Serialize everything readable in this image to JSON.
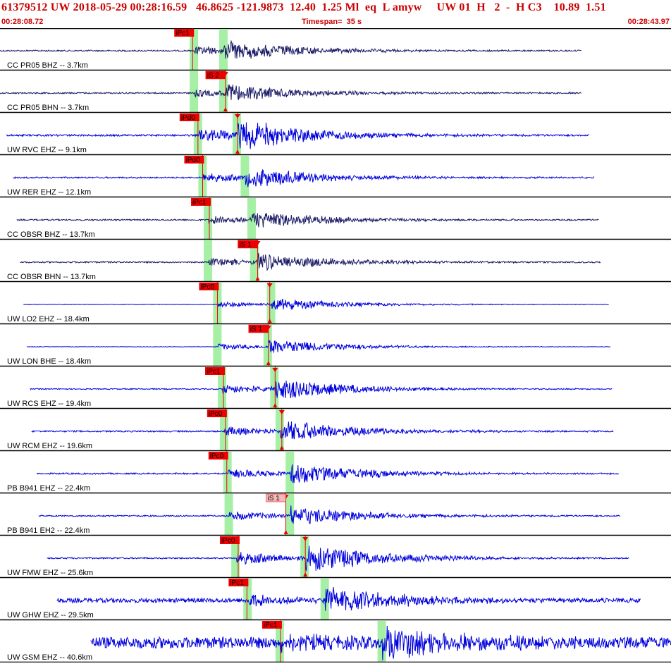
{
  "header": {
    "title": "61379512 UW 2018-05-29 00:28:16.59   46.8625 -121.9873  12.40  1.25 Ml  eq  L amyw     UW 01  H   2  -  H C3    10.89  1.51",
    "start_time": "00:28:08.72",
    "timespan": "Timespan=  35 s",
    "end_time": "00:28:43.97"
  },
  "colors": {
    "title_red": "#cc0000",
    "pick_red": "#ee0000",
    "pick_pink": "#f4b8b8",
    "window_green": "#a6f0a6",
    "trace_blue": "#0000dd",
    "trace_dark": "#1a1a66"
  },
  "traces": [
    {
      "label": "CC PR05 BHZ -- 3.7km",
      "color": "dark",
      "start": 0.0,
      "end": 0.867,
      "p": 0.29,
      "s": 0.334,
      "amp": 0.55,
      "noise": 0.04,
      "ppick": "iPc1",
      "ppick_at": 0.287,
      "spick": "",
      "spick_at": null
    },
    {
      "label": "CC PR05 BHN -- 3.7km",
      "color": "dark",
      "start": 0.0,
      "end": 0.867,
      "p": 0.29,
      "s": 0.334,
      "amp": 0.5,
      "noise": 0.04,
      "ppick": "",
      "ppick_at": null,
      "spick": "iS 2",
      "spick_at": 0.336
    },
    {
      "label": "UW RVC EHZ -- 9.1km",
      "color": "blue",
      "start": 0.01,
      "end": 0.878,
      "p": 0.296,
      "s": 0.354,
      "amp": 0.85,
      "noise": 0.05,
      "ppick": "iPd0",
      "ppick_at": 0.295,
      "spick": "",
      "spick_at": 0.354
    },
    {
      "label": "UW RER EHZ -- 12.1km",
      "color": "blue",
      "start": 0.02,
      "end": 0.886,
      "p": 0.303,
      "s": 0.366,
      "amp": 0.55,
      "noise": 0.04,
      "ppick": "iPd0",
      "ppick_at": 0.302,
      "spick": "",
      "spick_at": null
    },
    {
      "label": "CC OBSR BHZ -- 13.7km",
      "color": "dark",
      "start": 0.025,
      "end": 0.893,
      "p": 0.311,
      "s": 0.376,
      "amp": 0.5,
      "noise": 0.04,
      "ppick": "iPc1",
      "ppick_at": 0.312,
      "spick": "",
      "spick_at": null
    },
    {
      "label": "CC OBSR BHN -- 13.7km",
      "color": "dark",
      "start": 0.03,
      "end": 0.895,
      "p": 0.311,
      "s": 0.38,
      "amp": 0.5,
      "noise": 0.04,
      "ppick": "",
      "ppick_at": null,
      "spick": "iS 1",
      "spick_at": 0.384
    },
    {
      "label": "UW LO2 EHZ -- 18.4km",
      "color": "blue",
      "start": 0.035,
      "end": 0.908,
      "p": 0.325,
      "s": 0.405,
      "amp": 0.35,
      "noise": 0.015,
      "ppick": "iPc0",
      "ppick_at": 0.324,
      "spick": "",
      "spick_at": 0.402
    },
    {
      "label": "UW LON BHE -- 18.4km",
      "color": "blue",
      "start": 0.04,
      "end": 0.91,
      "p": 0.325,
      "s": 0.4,
      "amp": 0.4,
      "noise": 0.012,
      "ppick": "",
      "ppick_at": null,
      "spick": "iS 1",
      "spick_at": 0.4
    },
    {
      "label": "UW RCS EHZ -- 19.4km",
      "color": "blue",
      "start": 0.045,
      "end": 0.913,
      "p": 0.332,
      "s": 0.41,
      "amp": 0.6,
      "noise": 0.03,
      "ppick": "iPc1",
      "ppick_at": 0.333,
      "spick": "",
      "spick_at": 0.41
    },
    {
      "label": "UW RCM EHZ -- 19.6km",
      "color": "blue",
      "start": 0.047,
      "end": 0.915,
      "p": 0.335,
      "s": 0.418,
      "amp": 0.6,
      "noise": 0.04,
      "ppick": "iPc0",
      "ppick_at": 0.336,
      "spick": "",
      "spick_at": 0.42
    },
    {
      "label": "PB B941 EHZ -- 22.4km",
      "color": "blue",
      "start": 0.055,
      "end": 0.923,
      "p": 0.34,
      "s": 0.433,
      "amp": 0.6,
      "noise": 0.04,
      "ppick": "iPc0",
      "ppick_at": 0.338,
      "spick": "",
      "spick_at": null
    },
    {
      "label": "PB B941 EH2 -- 22.4km",
      "color": "blue",
      "start": 0.058,
      "end": 0.925,
      "p": 0.342,
      "s": 0.433,
      "amp": 0.55,
      "noise": 0.04,
      "ppick": "",
      "ppick_at": null,
      "spick": "iS 1",
      "spick_at": 0.426,
      "spick_pink": true
    },
    {
      "label": "UW FMW EHZ -- 25.6km",
      "color": "blue",
      "start": 0.07,
      "end": 0.938,
      "p": 0.352,
      "s": 0.455,
      "amp": 0.8,
      "noise": 0.04,
      "ppick": "iPc0",
      "ppick_at": 0.355,
      "spick": "",
      "spick_at": 0.455
    },
    {
      "label": "UW GHW EHZ -- 29.5km",
      "color": "blue",
      "start": 0.085,
      "end": 0.955,
      "p": 0.37,
      "s": 0.485,
      "amp": 0.7,
      "noise": 0.12,
      "ppick": "iPc1",
      "ppick_at": 0.368,
      "spick": "",
      "spick_at": null
    },
    {
      "label": "UW GSM EHZ -- 40.6km",
      "color": "blue",
      "start": 0.135,
      "end": 1.0,
      "p": 0.418,
      "s": 0.57,
      "amp": 0.9,
      "noise": 0.32,
      "ppick": "iPc1",
      "ppick_at": 0.418,
      "spick": "",
      "spick_at": null
    }
  ]
}
